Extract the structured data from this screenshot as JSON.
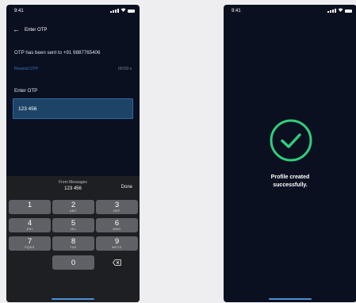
{
  "screen_otp": {
    "status_time": "9:41",
    "header_title": "Enter OTP",
    "sent_message": "OTP has been sent to +91 9887765406",
    "resend_label": "Resend OTP",
    "timer": "00:59 s",
    "otp_label": "Enter OTP",
    "otp_value": "123 456",
    "keyboard": {
      "suggestion_from": "From Messages",
      "suggestion_code": "123 456",
      "done_label": "Done",
      "keys": [
        {
          "num": "1",
          "letters": ""
        },
        {
          "num": "2",
          "letters": "ABC"
        },
        {
          "num": "3",
          "letters": "DEF"
        },
        {
          "num": "4",
          "letters": "GHI"
        },
        {
          "num": "5",
          "letters": "JKL"
        },
        {
          "num": "6",
          "letters": "MNO"
        },
        {
          "num": "7",
          "letters": "PQRS"
        },
        {
          "num": "8",
          "letters": "TUV"
        },
        {
          "num": "9",
          "letters": "WXYZ"
        },
        {
          "num": "0",
          "letters": ""
        }
      ]
    }
  },
  "screen_success": {
    "status_time": "9:41",
    "line1": "Profile created",
    "line2": "successfully."
  },
  "colors": {
    "background": "#0a1020",
    "accent": "#2a6aa3",
    "success": "#2fcf7d",
    "link": "#3a76c0"
  },
  "icons": [
    "back-arrow-icon",
    "signal-icon",
    "wifi-icon",
    "battery-icon",
    "backspace-icon",
    "check-circle-icon"
  ]
}
